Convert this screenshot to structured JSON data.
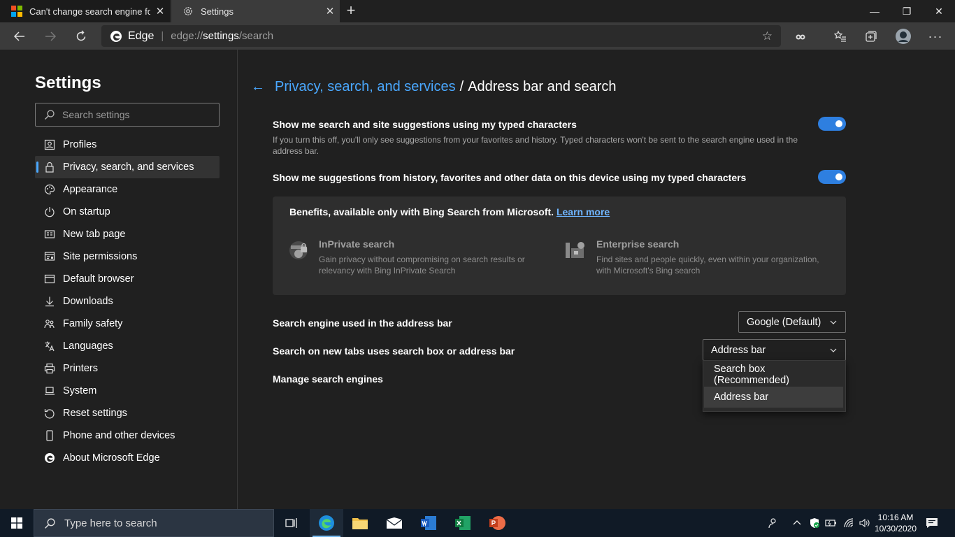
{
  "tabs": [
    {
      "title": "Can't change search engine for t",
      "close": "✕"
    },
    {
      "title": "Settings",
      "close": "✕"
    }
  ],
  "new_tab": "+",
  "window_controls": {
    "minimize": "—",
    "restore": "❐",
    "close": "✕"
  },
  "address_bar": {
    "site_label": "Edge",
    "url_prefix": "edge://",
    "url_bold": "settings",
    "url_suffix": "/search"
  },
  "sidebar": {
    "title": "Settings",
    "search_placeholder": "Search settings",
    "items": [
      {
        "label": "Profiles",
        "icon": "profile-icon"
      },
      {
        "label": "Privacy, search, and services",
        "icon": "lock-icon",
        "active": true
      },
      {
        "label": "Appearance",
        "icon": "palette-icon"
      },
      {
        "label": "On startup",
        "icon": "power-icon"
      },
      {
        "label": "New tab page",
        "icon": "newtab-icon"
      },
      {
        "label": "Site permissions",
        "icon": "site-permissions-icon"
      },
      {
        "label": "Default browser",
        "icon": "browser-icon"
      },
      {
        "label": "Downloads",
        "icon": "download-icon"
      },
      {
        "label": "Family safety",
        "icon": "family-icon"
      },
      {
        "label": "Languages",
        "icon": "languages-icon"
      },
      {
        "label": "Printers",
        "icon": "printer-icon"
      },
      {
        "label": "System",
        "icon": "laptop-icon"
      },
      {
        "label": "Reset settings",
        "icon": "reset-icon"
      },
      {
        "label": "Phone and other devices",
        "icon": "phone-icon"
      },
      {
        "label": "About Microsoft Edge",
        "icon": "edge-icon"
      }
    ]
  },
  "breadcrumb": {
    "parent": "Privacy, search, and services",
    "separator": "/",
    "current": "Address bar and search"
  },
  "settings": {
    "suggestions_typed": {
      "title": "Show me search and site suggestions using my typed characters",
      "description": "If you turn this off, you'll only see suggestions from your favorites and history. Typed characters won't be sent to the search engine used in the address bar.",
      "enabled": true
    },
    "suggestions_history": {
      "title": "Show me suggestions from history, favorites and other data on this device using my typed characters",
      "enabled": true
    }
  },
  "bing_card": {
    "heading": "Benefits, available only with Bing Search from Microsoft.",
    "learn_more": "Learn more",
    "benefits": [
      {
        "title": "InPrivate search",
        "description": "Gain privacy without compromising on search results or relevancy with Bing InPrivate Search"
      },
      {
        "title": "Enterprise search",
        "description": "Find sites and people quickly, even within your organization, with Microsoft's Bing search"
      }
    ]
  },
  "search_engine": {
    "label": "Search engine used in the address bar",
    "value": "Google (Default)"
  },
  "new_tabs": {
    "label": "Search on new tabs uses search box or address bar",
    "value": "Address bar",
    "options": [
      "Search box (Recommended)",
      "Address bar"
    ],
    "selected_option": "Address bar"
  },
  "manage_engines": {
    "label": "Manage search engines"
  },
  "taskbar": {
    "search_placeholder": "Type here to search",
    "time": "10:16 AM",
    "date": "10/30/2020"
  },
  "colors": {
    "accent": "#4aa8ff",
    "toggle_on": "#2e7fe0",
    "background": "#202020",
    "toolbar": "#3b3b3b"
  }
}
